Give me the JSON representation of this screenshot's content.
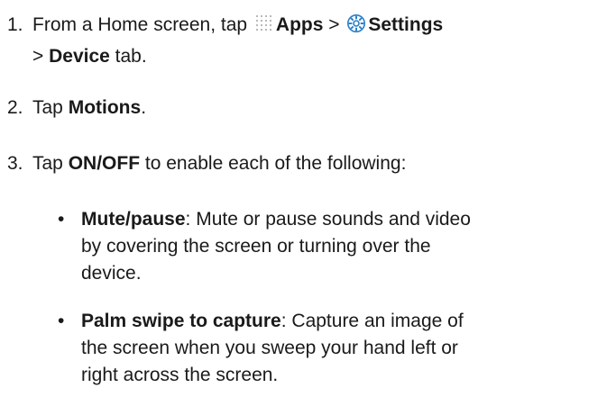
{
  "steps": [
    {
      "num": "1.",
      "pre": "From a Home screen, tap ",
      "apps_icon": "apps-grid-icon",
      "apps_label": "Apps",
      "sep1": " > ",
      "settings_icon": "settings-gear-icon",
      "settings_label": "Settings",
      "sep2": "> ",
      "device_label": "Device",
      "post": " tab."
    },
    {
      "num": "2.",
      "pre": "Tap ",
      "bold": "Motions",
      "post": "."
    },
    {
      "num": "3.",
      "pre": "Tap ",
      "bold": "ON/OFF",
      "post": " to enable each of the following:"
    }
  ],
  "bullets": [
    {
      "mark": "•",
      "term": "Mute/pause",
      "line1": ": Mute or pause sounds and video",
      "line2": "by covering the screen or turning over the",
      "line3": "device."
    },
    {
      "mark": "•",
      "term": "Palm swipe to capture",
      "line1": ": Capture an image of",
      "line2": "the screen when you sweep your hand left or",
      "line3": "right across the screen."
    }
  ],
  "colors": {
    "text": "#1a1a1a",
    "icon_blue": "#2a7fc9",
    "icon_grey": "#b8b8b8"
  }
}
